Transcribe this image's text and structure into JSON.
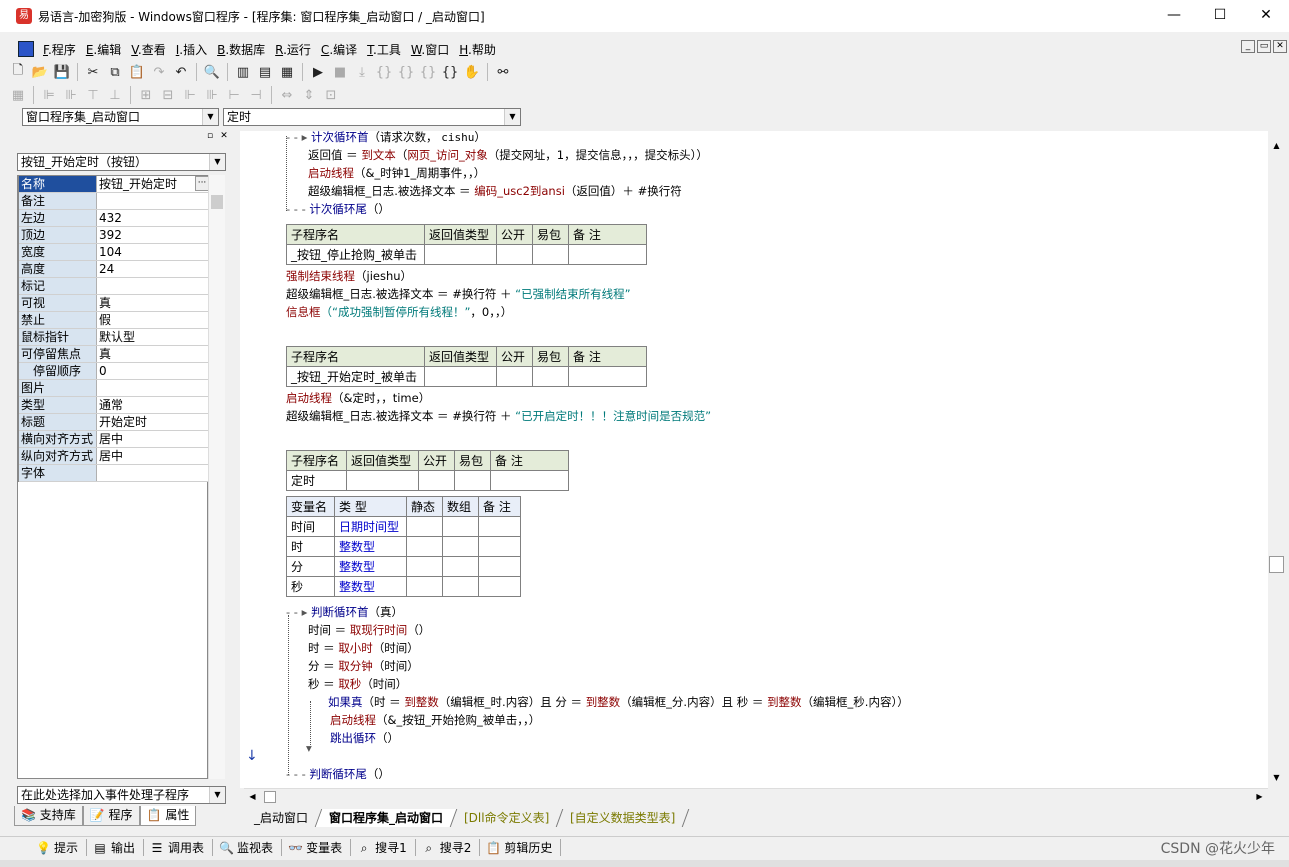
{
  "window": {
    "title": "易语言-加密狗版 - Windows窗口程序 - [程序集: 窗口程序集_启动窗口 / _启动窗口]",
    "minimize": "—",
    "maximize": "☐",
    "close": "✕"
  },
  "menu": [
    {
      "key": "F",
      "label": ".程序"
    },
    {
      "key": "E",
      "label": ".编辑"
    },
    {
      "key": "V",
      "label": ".查看"
    },
    {
      "key": "I",
      "label": ".插入"
    },
    {
      "key": "B",
      "label": ".数据库"
    },
    {
      "key": "R",
      "label": ".运行"
    },
    {
      "key": "C",
      "label": ".编译"
    },
    {
      "key": "T",
      "label": ".工具"
    },
    {
      "key": "W",
      "label": ".窗口"
    },
    {
      "key": "H",
      "label": ".帮助"
    }
  ],
  "selectors": {
    "assembly": "窗口程序集_启动窗口",
    "subroutine": "定时"
  },
  "left_panel": {
    "component_select": "按钮_开始定时（按钮）",
    "properties": [
      {
        "name": "名称",
        "value": "按钮_开始定时"
      },
      {
        "name": "备注",
        "value": ""
      },
      {
        "name": "左边",
        "value": "432"
      },
      {
        "name": "顶边",
        "value": "392"
      },
      {
        "name": "宽度",
        "value": "104"
      },
      {
        "name": "高度",
        "value": "24"
      },
      {
        "name": "标记",
        "value": ""
      },
      {
        "name": "可视",
        "value": "真"
      },
      {
        "name": "禁止",
        "value": "假"
      },
      {
        "name": "鼠标指针",
        "value": "默认型"
      },
      {
        "name": "可停留焦点",
        "value": "真"
      },
      {
        "name": "停留顺序",
        "value": "0"
      },
      {
        "name": "图片",
        "value": ""
      },
      {
        "name": "类型",
        "value": "通常"
      },
      {
        "name": "标题",
        "value": "开始定时"
      },
      {
        "name": "横向对齐方式",
        "value": "居中"
      },
      {
        "name": "纵向对齐方式",
        "value": "居中"
      },
      {
        "name": "字体",
        "value": ""
      }
    ],
    "event_select": "在此处选择加入事件处理子程序",
    "tabs": [
      "支持库",
      "程序",
      "属性"
    ]
  },
  "code": {
    "loop1_head": "计次循环首",
    "loop1_args": "（请求次数，",
    "loop1_var": "cishu",
    "loop1_close": "）",
    "line2_a": "返回值 ＝ ",
    "line2_fn": "到文本",
    "line2_b": "（",
    "line2_fn2": "网页_访问_对象",
    "line2_c": "（提交网址，1，提交信息，，，提交标头））",
    "line3_fn": "启动线程",
    "line3_args": "（&_时钟1_周期事件，，）",
    "line4_a": "超级编辑框_日志.被选择文本 ＝ ",
    "line4_fn": "编码_usc2到ansi",
    "line4_b": "（返回值）＋ #换行符",
    "loop1_tail": "计次循环尾",
    "loop1_tail_args": "（）",
    "sub_header": [
      "子程序名",
      "返回值类型",
      "公开",
      "易包",
      "备 注"
    ],
    "sub1_name": "_按钮_停止抢购_被单击",
    "s1_l1_fn": "强制结束线程",
    "s1_l1_args": "（jieshu）",
    "s1_l2_a": "超级编辑框_日志.被选择文本 ＝ #换行符 ＋ ",
    "s1_l2_str": "“已强制结束所有线程”",
    "s1_l3_fn": "信息框",
    "s1_l3_str": "（“成功强制暂停所有线程！”",
    "s1_l3_b": "，0，，）",
    "sub2_name": "_按钮_开始定时_被单击",
    "s2_l1_fn": "启动线程",
    "s2_l1_args": "（&定时，，time）",
    "s2_l2_a": "超级编辑框_日志.被选择文本 ＝ #换行符 ＋ ",
    "s2_l2_str": "“已开启定时！！！注意时间是否规范”",
    "sub3_name": "定时",
    "var_header": [
      "变量名",
      "类 型",
      "静态",
      "数组",
      "备 注"
    ],
    "vars": [
      {
        "name": "时间",
        "type": "日期时间型"
      },
      {
        "name": "时",
        "type": "整数型"
      },
      {
        "name": "分",
        "type": "整数型"
      },
      {
        "name": "秒",
        "type": "整数型"
      }
    ],
    "loop2_head": "判断循环首",
    "loop2_args": "（真）",
    "l2_1a": "时间 ＝ ",
    "l2_1fn": "取现行时间",
    "l2_1b": "（）",
    "l2_2a": "时 ＝ ",
    "l2_2fn": "取小时",
    "l2_2b": "（时间）",
    "l2_3a": "分 ＝ ",
    "l2_3fn": "取分钟",
    "l2_3b": "（时间）",
    "l2_4a": "秒 ＝ ",
    "l2_4fn": "取秒",
    "l2_4b": "（时间）",
    "if_kw": "如果真",
    "if_a": "（时 ＝ ",
    "if_fn1": "到整数",
    "if_b": "（编辑框_时.内容）且 分 ＝ ",
    "if_fn2": "到整数",
    "if_c": "（编辑框_分.内容）且 秒 ＝ ",
    "if_fn3": "到整数",
    "if_d": "（编辑框_秒.内容））",
    "if_l1_fn": "启动线程",
    "if_l1_args": "（&_按钮_开始抢购_被单击，，）",
    "if_l2_fn": "跳出循环",
    "if_l2_args": "（）",
    "loop2_tail": "判断循环尾",
    "loop2_tail_args": "（）"
  },
  "editor_tabs": [
    "_启动窗口",
    "窗口程序集_启动窗口",
    "[Dll命令定义表]",
    "[自定义数据类型表]"
  ],
  "bottom_tabs": [
    "提示",
    "输出",
    "调用表",
    "监视表",
    "变量表",
    "搜寻1",
    "搜寻2",
    "剪辑历史"
  ],
  "watermark": "CSDN @花火少年"
}
